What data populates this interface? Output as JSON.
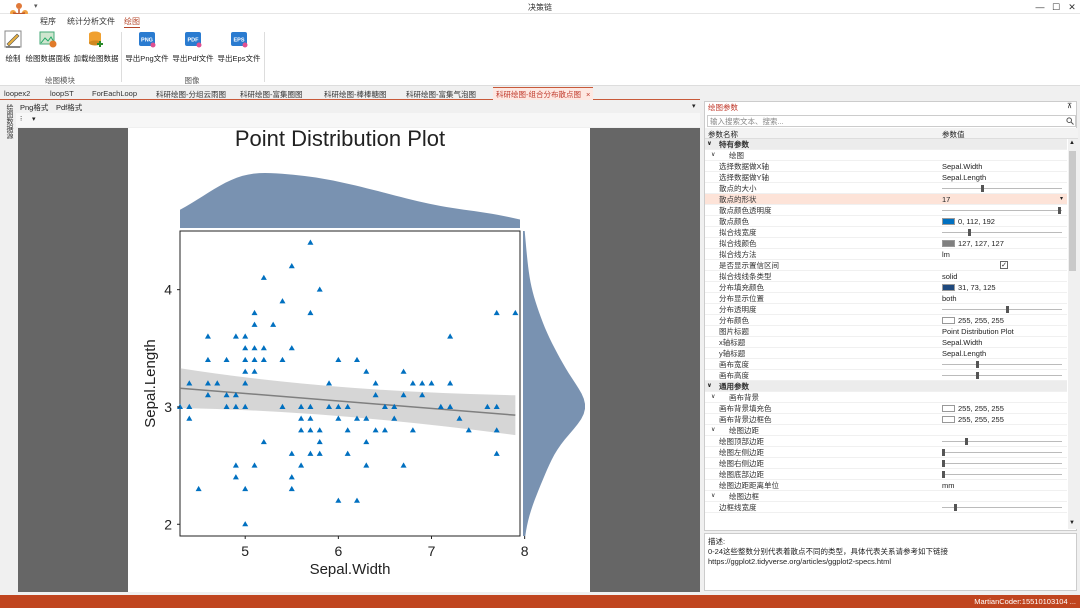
{
  "window": {
    "title": "决策链",
    "min": "—",
    "max": "☐",
    "close": "✕"
  },
  "ribbon_tabs": [
    {
      "label": "程序",
      "x": 40
    },
    {
      "label": "统计分析文件",
      "x": 67
    },
    {
      "label": "绘图",
      "x": 124
    }
  ],
  "ribbon": {
    "buttons": [
      {
        "label": "绘制",
        "icon": "pencil-icon"
      },
      {
        "label": "绘图数据面板",
        "icon": "image-panel-icon"
      },
      {
        "label": "加载绘图数据",
        "icon": "database-add-icon"
      },
      {
        "label": "导出Png文件",
        "icon": "png-icon",
        "badge": "PNG"
      },
      {
        "label": "导出Pdf文件",
        "icon": "pdf-icon",
        "badge": "PDF"
      },
      {
        "label": "导出Eps文件",
        "icon": "eps-icon",
        "badge": "EPS"
      }
    ],
    "groups": [
      "绘图模块",
      "图像"
    ]
  },
  "doc_tabs": [
    "loopex2",
    "loopST",
    "ForEachLoop",
    "科研绘图-分组云雨图",
    "科研绘图-富集圈图",
    "科研绘图-棒棒糖图",
    "科研绘图-富集气泡图",
    "科研绘图-组合分布散点图"
  ],
  "doc_tab_close": "×",
  "subtabs": [
    "Png格式",
    "Pdf格式"
  ],
  "left_vtab": "绘图数据源",
  "chart_data": {
    "type": "scatter",
    "title": "Point Distribution Plot",
    "xlabel": "Sepal.Width",
    "ylabel": "Sepal.Length",
    "xlim": [
      4.3,
      7.95
    ],
    "ylim": [
      1.9,
      4.5
    ],
    "xticks": [
      5,
      6,
      7,
      8
    ],
    "yticks": [
      2,
      3,
      4
    ],
    "fit_line": {
      "x": [
        4.3,
        7.9
      ],
      "y": [
        3.16,
        2.93
      ]
    },
    "points": [
      [
        4.4,
        2.9
      ],
      [
        4.3,
        3.0
      ],
      [
        4.4,
        3.0
      ],
      [
        4.4,
        3.2
      ],
      [
        4.5,
        2.3
      ],
      [
        4.6,
        3.1
      ],
      [
        4.6,
        3.4
      ],
      [
        4.6,
        3.6
      ],
      [
        4.6,
        3.2
      ],
      [
        4.7,
        3.2
      ],
      [
        4.8,
        3.0
      ],
      [
        4.8,
        3.4
      ],
      [
        4.8,
        3.1
      ],
      [
        4.9,
        3.0
      ],
      [
        4.9,
        3.1
      ],
      [
        4.9,
        2.5
      ],
      [
        4.9,
        3.6
      ],
      [
        5.0,
        3.6
      ],
      [
        5.0,
        3.4
      ],
      [
        5.0,
        3.0
      ],
      [
        5.0,
        3.3
      ],
      [
        5.0,
        3.5
      ],
      [
        5.0,
        3.2
      ],
      [
        5.0,
        2.3
      ],
      [
        5.0,
        2.0
      ],
      [
        4.9,
        2.4
      ],
      [
        5.1,
        3.5
      ],
      [
        5.1,
        3.8
      ],
      [
        5.1,
        3.7
      ],
      [
        5.1,
        3.3
      ],
      [
        5.1,
        3.4
      ],
      [
        5.1,
        2.5
      ],
      [
        5.2,
        3.5
      ],
      [
        5.2,
        3.4
      ],
      [
        5.2,
        4.1
      ],
      [
        5.2,
        2.7
      ],
      [
        5.3,
        3.7
      ],
      [
        5.4,
        3.9
      ],
      [
        5.4,
        3.4
      ],
      [
        5.4,
        3.0
      ],
      [
        5.5,
        4.2
      ],
      [
        5.5,
        3.5
      ],
      [
        5.5,
        2.3
      ],
      [
        5.5,
        2.4
      ],
      [
        5.5,
        2.6
      ],
      [
        5.6,
        2.9
      ],
      [
        5.6,
        3.0
      ],
      [
        5.6,
        2.5
      ],
      [
        5.6,
        2.8
      ],
      [
        5.7,
        4.4
      ],
      [
        5.7,
        3.8
      ],
      [
        5.7,
        2.8
      ],
      [
        5.7,
        2.6
      ],
      [
        5.7,
        3.0
      ],
      [
        5.7,
        2.9
      ],
      [
        5.8,
        4.0
      ],
      [
        5.8,
        2.7
      ],
      [
        5.8,
        2.8
      ],
      [
        5.8,
        2.6
      ],
      [
        5.9,
        3.0
      ],
      [
        5.9,
        3.2
      ],
      [
        6.0,
        3.4
      ],
      [
        6.0,
        2.2
      ],
      [
        6.0,
        2.9
      ],
      [
        6.0,
        3.0
      ],
      [
        6.1,
        2.8
      ],
      [
        6.1,
        3.0
      ],
      [
        6.1,
        2.6
      ],
      [
        6.2,
        2.9
      ],
      [
        6.2,
        3.4
      ],
      [
        6.2,
        2.2
      ],
      [
        6.3,
        3.3
      ],
      [
        6.3,
        2.7
      ],
      [
        6.3,
        2.5
      ],
      [
        6.3,
        2.9
      ],
      [
        6.4,
        3.2
      ],
      [
        6.4,
        2.8
      ],
      [
        6.4,
        3.1
      ],
      [
        6.5,
        3.0
      ],
      [
        6.5,
        2.8
      ],
      [
        6.6,
        3.0
      ],
      [
        6.6,
        2.9
      ],
      [
        6.7,
        3.1
      ],
      [
        6.7,
        3.3
      ],
      [
        6.7,
        2.5
      ],
      [
        6.8,
        2.8
      ],
      [
        6.8,
        3.2
      ],
      [
        6.9,
        3.1
      ],
      [
        6.9,
        3.2
      ],
      [
        7.0,
        3.2
      ],
      [
        7.1,
        3.0
      ],
      [
        7.2,
        3.6
      ],
      [
        7.2,
        3.2
      ],
      [
        7.2,
        3.0
      ],
      [
        7.3,
        2.9
      ],
      [
        7.4,
        2.8
      ],
      [
        7.6,
        3.0
      ],
      [
        7.7,
        3.8
      ],
      [
        7.7,
        2.6
      ],
      [
        7.7,
        2.8
      ],
      [
        7.7,
        3.0
      ],
      [
        7.9,
        3.8
      ]
    ],
    "marker_color": "#0070C0",
    "fill_color": "#1F497D",
    "alpha": 0.6
  },
  "props": {
    "title": "绘图参数",
    "pin": "⊼",
    "search_placeholder": "输入搜索文本、搜索...",
    "col_name": "参数名称",
    "col_value": "参数值",
    "rows": [
      {
        "type": "cat",
        "k": "特有参数"
      },
      {
        "type": "sub",
        "k": "绘图"
      },
      {
        "type": "text",
        "k": "选择数据做X轴",
        "v": "Sepal.Width"
      },
      {
        "type": "text",
        "k": "选择数据做Y轴",
        "v": "Sepal.Length"
      },
      {
        "type": "slider",
        "k": "散点的大小",
        "level": 0.33
      },
      {
        "type": "text",
        "k": "散点的形状",
        "v": "17",
        "sel": true
      },
      {
        "type": "slider",
        "k": "散点颜色透明度",
        "level": 0.99
      },
      {
        "type": "color",
        "k": "散点颜色",
        "v": "0, 112, 192",
        "color": "#0070C0"
      },
      {
        "type": "slider",
        "k": "拟合线宽度",
        "level": 0.22
      },
      {
        "type": "color",
        "k": "拟合线颜色",
        "v": "127, 127, 127",
        "color": "#7F7F7F"
      },
      {
        "type": "text",
        "k": "拟合线方法",
        "v": "lm"
      },
      {
        "type": "check",
        "k": "是否显示置信区间",
        "v": "✓"
      },
      {
        "type": "text",
        "k": "拟合线线条类型",
        "v": "solid"
      },
      {
        "type": "color",
        "k": "分布填充颜色",
        "v": "31, 73, 125",
        "color": "#1F497D"
      },
      {
        "type": "text",
        "k": "分布显示位置",
        "v": "both"
      },
      {
        "type": "slider",
        "k": "分布透明度",
        "level": 0.55
      },
      {
        "type": "color",
        "k": "分布颜色",
        "v": "255, 255, 255",
        "color": "#FFFFFF"
      },
      {
        "type": "text",
        "k": "图片标题",
        "v": "Point Distribution Plot"
      },
      {
        "type": "text",
        "k": "x轴标题",
        "v": "Sepal.Width"
      },
      {
        "type": "text",
        "k": "y轴标题",
        "v": "Sepal.Length"
      },
      {
        "type": "slider",
        "k": "画布宽度",
        "level": 0.29
      },
      {
        "type": "slider",
        "k": "画布高度",
        "level": 0.29
      },
      {
        "type": "cat",
        "k": "通用参数"
      },
      {
        "type": "sub",
        "k": "画布背景"
      },
      {
        "type": "color",
        "k": "画布背景填充色",
        "v": "255, 255, 255",
        "color": "#FFFFFF"
      },
      {
        "type": "color",
        "k": "画布背景边框色",
        "v": "255, 255, 255",
        "color": "#FFFFFF"
      },
      {
        "type": "sub",
        "k": "绘图边距"
      },
      {
        "type": "slider",
        "k": "绘图顶部边距",
        "level": 0.2
      },
      {
        "type": "slider",
        "k": "绘图左侧边距",
        "level": 0.0
      },
      {
        "type": "slider",
        "k": "绘图右侧边距",
        "level": 0.0
      },
      {
        "type": "slider",
        "k": "绘图底部边距",
        "level": 0.0
      },
      {
        "type": "text",
        "k": "绘图边距距离单位",
        "v": "mm"
      },
      {
        "type": "sub",
        "k": "绘图边框"
      },
      {
        "type": "slider",
        "k": "边框线宽度",
        "level": 0.1
      }
    ]
  },
  "desc": {
    "label": "描述:",
    "line1": "0-24这些整数分别代表着散点不同的类型，具体代表关系请参考如下链接",
    "line2": "https://ggplot2.tidyverse.org/articles/ggplot2-specs.html"
  },
  "status": "MartianCoder:15510103104 ..."
}
